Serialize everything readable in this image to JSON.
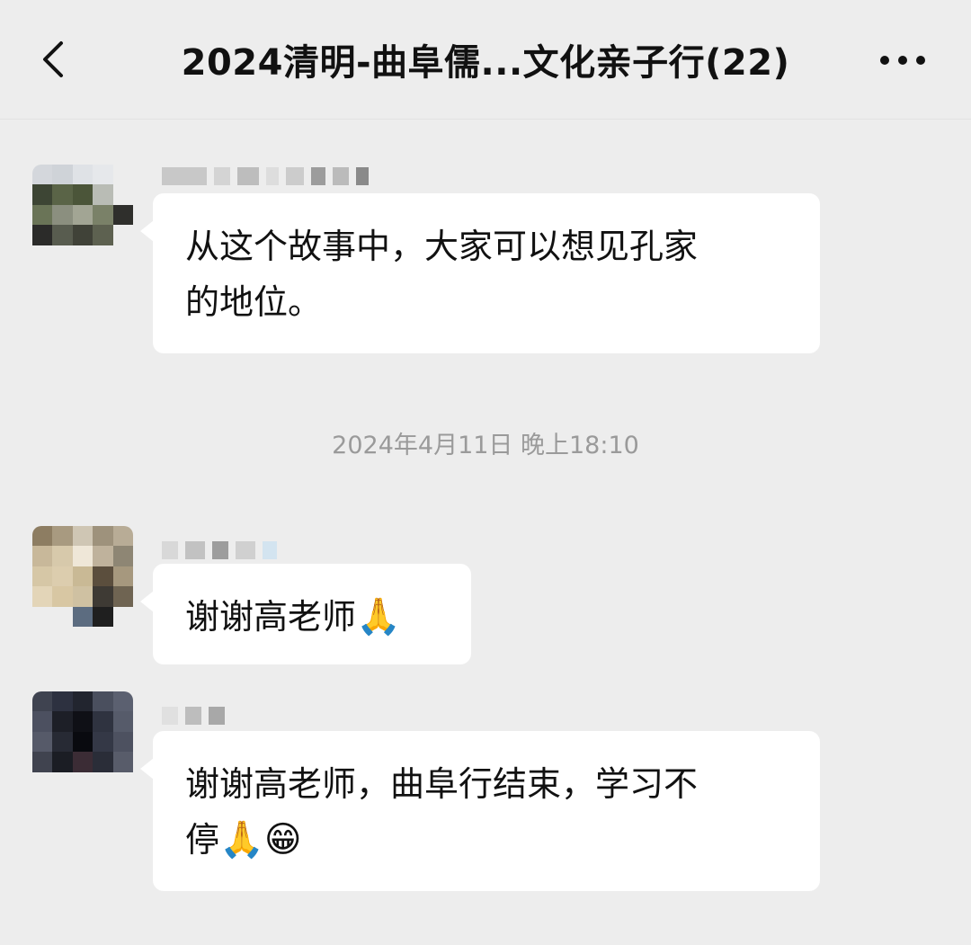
{
  "header": {
    "title": "2024清明-曲阜儒...文化亲子行(22)",
    "back_icon": "chevron-left-icon",
    "more_icon": "more-dots-icon"
  },
  "messages": [
    {
      "text": "从这个故事中，大家可以想见孔家的地位。",
      "line1": "从这个故事中，大家可以想见孔家",
      "line2": "的地位。"
    },
    {
      "text": "谢谢高老师🙏",
      "text_main": "谢谢高老师",
      "emoji1": "🙏"
    },
    {
      "text": "谢谢高老师，曲阜行结束，学习不停🙏😁",
      "line1": "谢谢高老师，曲阜行结束，学习不",
      "line2_text": "停",
      "emoji1": "🙏",
      "emoji2": "😁"
    }
  ],
  "timestamp": "2024年4月11日 晚上18:10",
  "colors": {
    "background": "#ededed",
    "bubble": "#ffffff",
    "timestamp": "#9a9a9a"
  }
}
